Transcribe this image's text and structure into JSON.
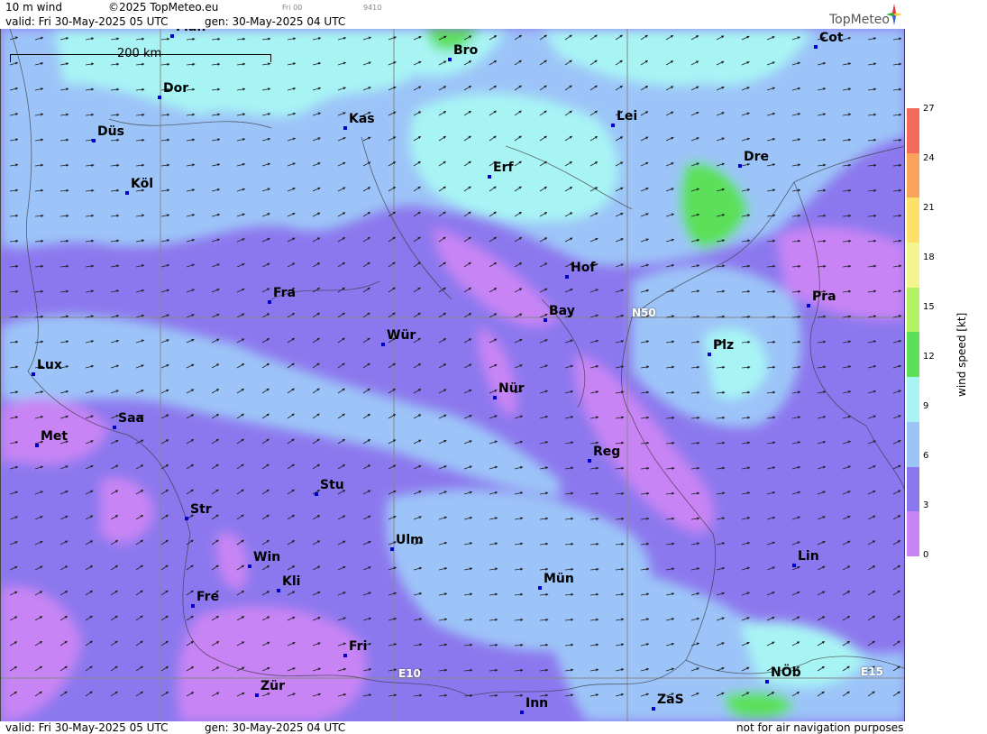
{
  "header": {
    "product": "10 m wind",
    "copyright": "©2025 TopMeteo.eu",
    "step": "Fri 00",
    "code": "9410",
    "valid": "valid:  Fri  30-May-2025  05 UTC",
    "gen": "gen:  30-May-2025 04 UTC",
    "logo": "TopMeteo"
  },
  "footer": {
    "valid": "valid:  Fri  30-May-2025  05 UTC",
    "gen": "gen:  30-May-2025 04 UTC",
    "note": "not for air navigation purposes"
  },
  "scale_label": "200 km",
  "grid_labels": [
    "N50",
    "E10",
    "E15"
  ],
  "cities": [
    {
      "name": "Man"
    },
    {
      "name": "Bro"
    },
    {
      "name": "Cot"
    },
    {
      "name": "Dor"
    },
    {
      "name": "Kas"
    },
    {
      "name": "Lei"
    },
    {
      "name": "Düs"
    },
    {
      "name": "Erf"
    },
    {
      "name": "Dre"
    },
    {
      "name": "Köl"
    },
    {
      "name": "Hof"
    },
    {
      "name": "Fra"
    },
    {
      "name": "Pra"
    },
    {
      "name": "Bay"
    },
    {
      "name": "Wür"
    },
    {
      "name": "Plz"
    },
    {
      "name": "Lux"
    },
    {
      "name": "Nür"
    },
    {
      "name": "Saa"
    },
    {
      "name": "Met"
    },
    {
      "name": "Reg"
    },
    {
      "name": "Stu"
    },
    {
      "name": "Str"
    },
    {
      "name": "Ulm"
    },
    {
      "name": "Lin"
    },
    {
      "name": "Win"
    },
    {
      "name": "Mün"
    },
    {
      "name": "Kli"
    },
    {
      "name": "Fre"
    },
    {
      "name": "Fri"
    },
    {
      "name": "NÖb"
    },
    {
      "name": "Zür"
    },
    {
      "name": "ZaS"
    },
    {
      "name": "Inn"
    }
  ],
  "legend": {
    "unit": "wind speed [kt]",
    "ticks": [
      "27",
      "24",
      "21",
      "18",
      "15",
      "12",
      "9",
      "6",
      "3",
      "0"
    ],
    "colors": [
      "#f46a5a",
      "#f9a25a",
      "#fde06a",
      "#f5f590",
      "#b4f064",
      "#5ce05a",
      "#a8f4f4",
      "#9cc4f8",
      "#8c78ee",
      "#c884f4"
    ]
  },
  "colors": {
    "calm": "#c884f4",
    "light": "#8c78ee",
    "moderate": "#9cc4f8",
    "fresh": "#a8f4f4",
    "strong": "#5ce05a"
  }
}
